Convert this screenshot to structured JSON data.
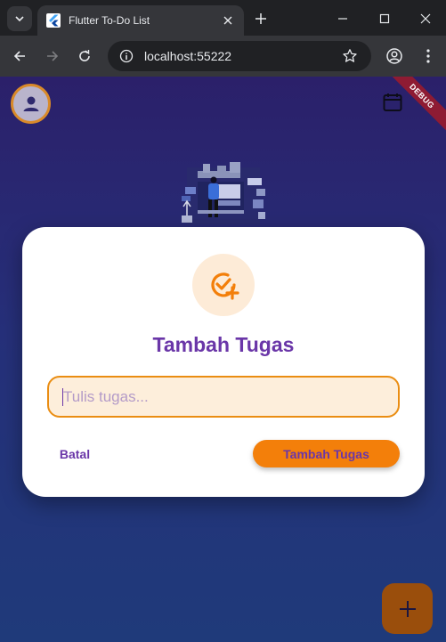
{
  "browser": {
    "tab_title": "Flutter To-Do List",
    "url": "localhost:55222"
  },
  "app": {
    "debug_banner": "DEBUG",
    "dialog": {
      "title": "Tambah Tugas",
      "input_placeholder": "Tulis tugas...",
      "input_value": "",
      "cancel_label": "Batal",
      "confirm_label": "Tambah Tugas"
    }
  },
  "colors": {
    "accent_orange": "#f37f0a",
    "title_purple": "#6a36a8",
    "background_top": "#2b206a",
    "background_bottom": "#1f3a7a"
  },
  "icons": {
    "avatar": "person-icon",
    "calendar": "calendar-icon",
    "dialog": "add-task-icon",
    "fab": "plus-icon"
  }
}
